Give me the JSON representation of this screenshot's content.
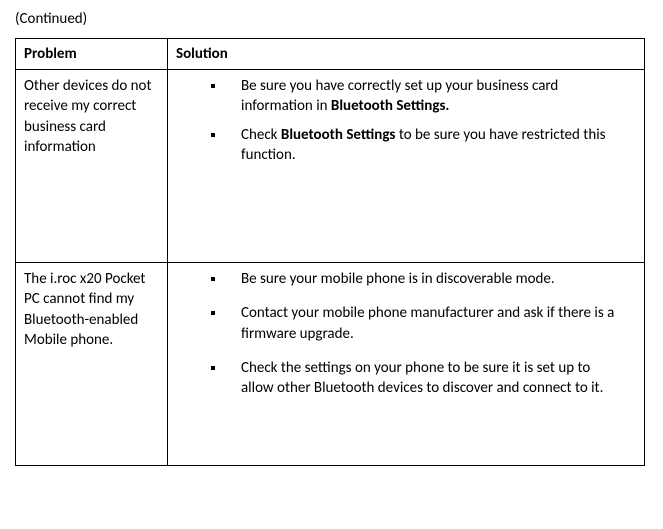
{
  "continued_label": "(Continued)",
  "headers": {
    "problem": "Problem",
    "solution": "Solution"
  },
  "rows": [
    {
      "problem": "Other devices do not receive my correct business card information",
      "solutions": [
        {
          "pre": "Be sure you have correctly set up your business card information in ",
          "bold": "Bluetooth Settings.",
          "post": ""
        },
        {
          "pre": "Check ",
          "bold": "Bluetooth Settings",
          "post": " to be sure you have restricted this function."
        }
      ]
    },
    {
      "problem": "The i.roc x20 Pocket PC cannot find my Bluetooth-enabled Mobile phone.",
      "solutions": [
        {
          "pre": "Be sure your mobile phone is in discoverable mode.",
          "bold": "",
          "post": ""
        },
        {
          "pre": "Contact your mobile phone manufacturer and ask if there is a firmware upgrade.",
          "bold": "",
          "post": ""
        },
        {
          "pre": "Check the settings on your phone to be sure it is set up to allow other Bluetooth devices to discover and connect to it.",
          "bold": "",
          "post": ""
        }
      ]
    }
  ]
}
